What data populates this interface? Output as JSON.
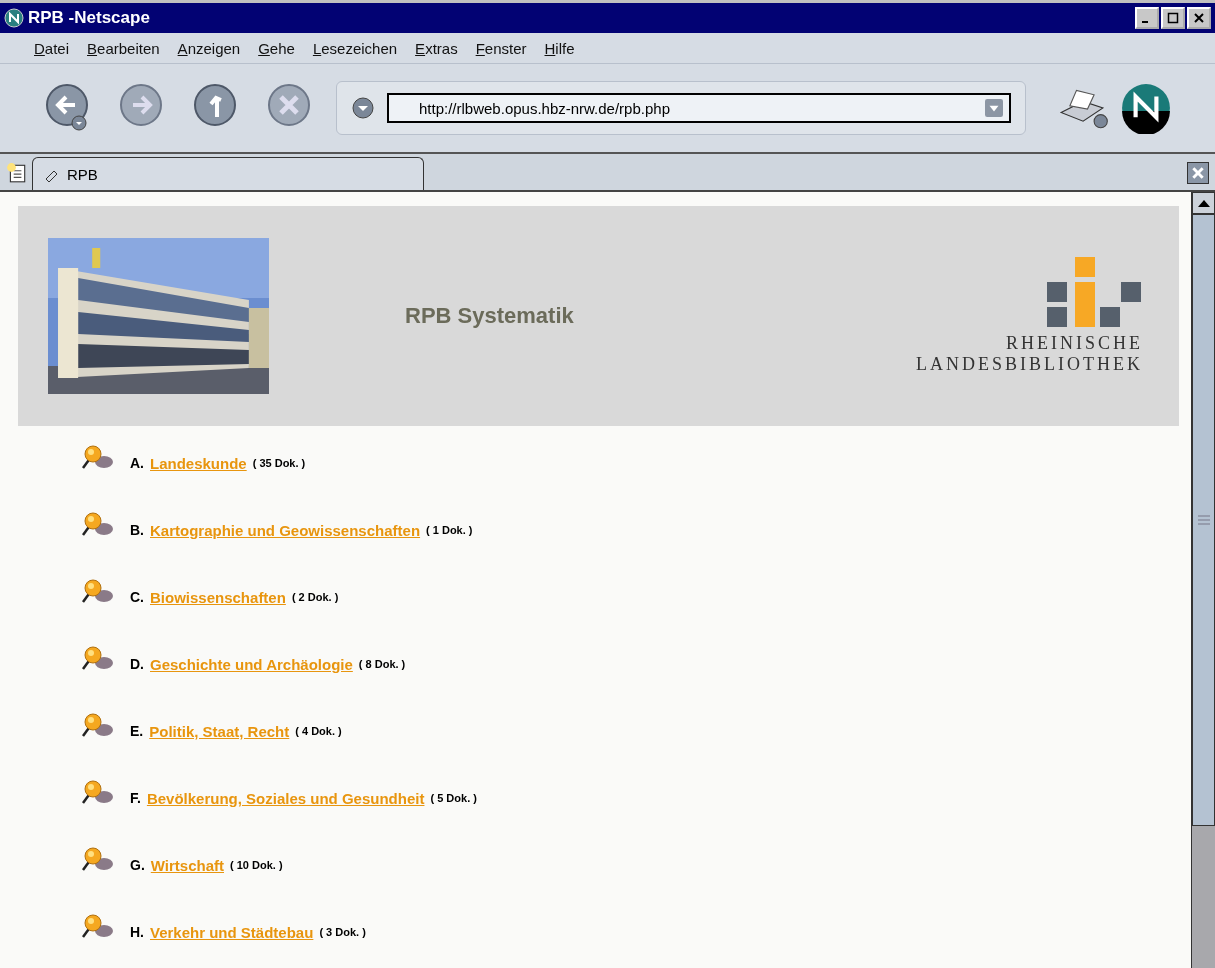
{
  "window": {
    "title": "RPB -Netscape"
  },
  "menu": [
    "Datei",
    "Bearbeiten",
    "Anzeigen",
    "Gehe",
    "Lesezeichen",
    "Extras",
    "Fenster",
    "Hilfe"
  ],
  "url": "http://rlbweb.opus.hbz-nrw.de/rpb.php",
  "tabs": [
    {
      "label": "RPB",
      "selected": true
    }
  ],
  "header": {
    "title": "RPB Systematik",
    "logo_lines": [
      "RHEINISCHE",
      "LANDESBIBLIOTHEK"
    ]
  },
  "categories": [
    {
      "letter": "A.",
      "label": "Landeskunde",
      "count": "( 35 Dok. )"
    },
    {
      "letter": "B.",
      "label": "Kartographie und Geowissenschaften",
      "count": "( 1 Dok. )"
    },
    {
      "letter": "C.",
      "label": "Biowissenschaften",
      "count": "( 2 Dok. )"
    },
    {
      "letter": "D.",
      "label": "Geschichte und Archäologie",
      "count": "( 8 Dok. )"
    },
    {
      "letter": "E.",
      "label": "Politik, Staat, Recht",
      "count": "( 4 Dok. )"
    },
    {
      "letter": "F.",
      "label": "Bevölkerung, Soziales und Gesundheit",
      "count": "( 5 Dok. )"
    },
    {
      "letter": "G.",
      "label": "Wirtschaft",
      "count": "( 10 Dok. )"
    },
    {
      "letter": "H.",
      "label": "Verkehr und Städtebau",
      "count": "( 3 Dok. )"
    }
  ]
}
